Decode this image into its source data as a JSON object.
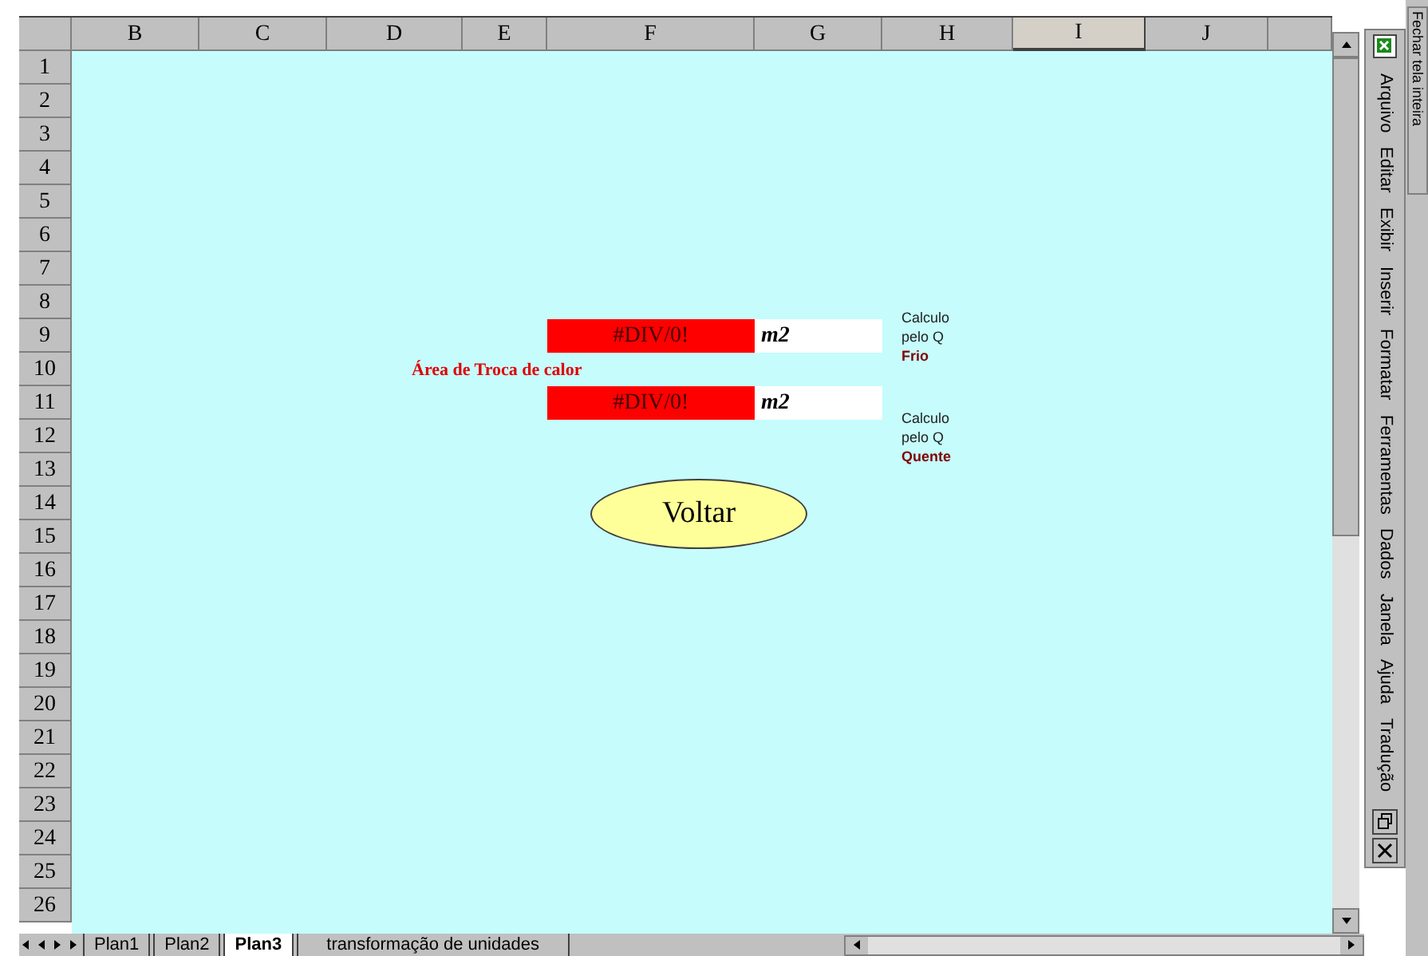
{
  "columns": [
    {
      "label": "B",
      "selected": false
    },
    {
      "label": "C",
      "selected": false
    },
    {
      "label": "D",
      "selected": false
    },
    {
      "label": "E",
      "selected": false
    },
    {
      "label": "F",
      "selected": false
    },
    {
      "label": "G",
      "selected": false
    },
    {
      "label": "H",
      "selected": false
    },
    {
      "label": "I",
      "selected": true
    },
    {
      "label": "J",
      "selected": false
    }
  ],
  "rows": [
    "1",
    "2",
    "3",
    "4",
    "5",
    "6",
    "7",
    "8",
    "9",
    "10",
    "11",
    "12",
    "13",
    "14",
    "15",
    "16",
    "17",
    "18",
    "19",
    "20",
    "21",
    "22",
    "23",
    "24",
    "25",
    "26"
  ],
  "label": "Área de Troca de calor",
  "results": [
    {
      "value": "#DIV/0!",
      "unit": "m2",
      "note": [
        "Calculo",
        "pelo Q"
      ],
      "emphasis": "Frio"
    },
    {
      "value": "#DIV/0!",
      "unit": "m2",
      "note": [
        "Calculo",
        "pelo Q"
      ],
      "emphasis": "Quente"
    }
  ],
  "button": "Voltar",
  "sheet_tabs": [
    {
      "label": "Plan1",
      "selected": false
    },
    {
      "label": "Plan2",
      "selected": false
    },
    {
      "label": "Plan3",
      "selected": true
    },
    {
      "label": "transformação de unidades",
      "selected": false
    }
  ],
  "menu": [
    "Arquivo",
    "Editar",
    "Exibir",
    "Inserir",
    "Formatar",
    "Ferramentas",
    "Dados",
    "Janela",
    "Ajuda",
    "Tradução"
  ],
  "fullscreen_toolbar": "Fechar tela inteira"
}
